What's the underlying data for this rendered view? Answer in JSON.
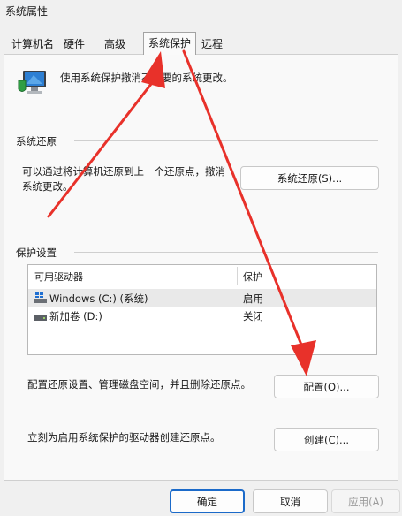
{
  "window": {
    "title": "系统属性"
  },
  "tabs": [
    {
      "label": "计算机名"
    },
    {
      "label": "硬件"
    },
    {
      "label": "高级"
    },
    {
      "label": "系统保护",
      "active": true
    },
    {
      "label": "远程"
    }
  ],
  "intro": {
    "text": "使用系统保护撤消不需要的系统更改。",
    "icon": "system-protection-icon"
  },
  "restore": {
    "section_title": "系统还原",
    "description": "可以通过将计算机还原到上一个还原点，撤消系统更改。",
    "button_label": "系统还原(S)..."
  },
  "protection": {
    "section_title": "保护设置",
    "columns": [
      "可用驱动器",
      "保护"
    ],
    "drives": [
      {
        "name": "Windows (C:) (系统)",
        "status": "启用",
        "icon": "system-drive-icon",
        "selected": true
      },
      {
        "name": "新加卷 (D:)",
        "status": "关闭",
        "icon": "drive-icon",
        "selected": false
      }
    ],
    "configure_text": "配置还原设置、管理磁盘空间，并且删除还原点。",
    "configure_button": "配置(O)...",
    "create_text": "立刻为启用系统保护的驱动器创建还原点。",
    "create_button": "创建(C)..."
  },
  "footer": {
    "ok": "确定",
    "cancel": "取消",
    "apply": "应用(A)"
  },
  "annotation": {
    "arrow_color": "#e8312a"
  }
}
